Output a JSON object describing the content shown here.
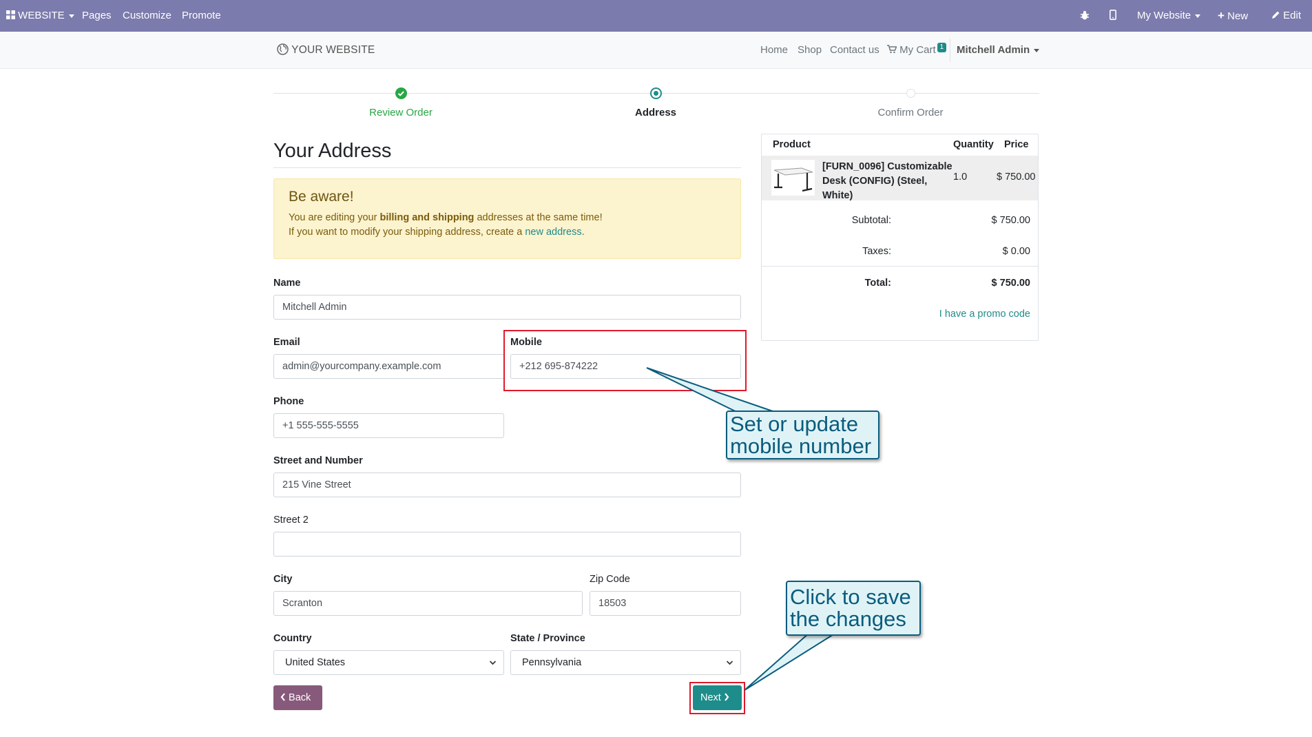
{
  "topbar": {
    "website_label": "WEBSITE",
    "pages": "Pages",
    "customize": "Customize",
    "promote": "Promote",
    "my_website": "My Website",
    "new": "New",
    "edit": "Edit"
  },
  "navbar": {
    "logo": "YOUR WEBSITE",
    "home": "Home",
    "shop": "Shop",
    "contact": "Contact us",
    "cart": "My Cart",
    "cart_count": "1",
    "user": "Mitchell Admin"
  },
  "steps": {
    "review": "Review Order",
    "address": "Address",
    "confirm": "Confirm Order"
  },
  "page_title": "Your Address",
  "alert": {
    "title": "Be aware!",
    "line1_pre": "You are editing your ",
    "line1_bold": "billing and shipping",
    "line1_post": " addresses at the same time!",
    "line2_pre": "If you want to modify your shipping address, create a ",
    "line2_link": "new address",
    "line2_post": "."
  },
  "form": {
    "name_label": "Name",
    "name_value": "Mitchell Admin",
    "email_label": "Email",
    "email_value": "admin@yourcompany.example.com",
    "mobile_label": "Mobile",
    "mobile_value": "+212 695-874222",
    "phone_label": "Phone",
    "phone_value": "+1 555-555-5555",
    "street_label": "Street and Number",
    "street_value": "215 Vine Street",
    "street2_label": "Street 2",
    "street2_value": "",
    "city_label": "City",
    "city_value": "Scranton",
    "zip_label": "Zip Code",
    "zip_value": "18503",
    "country_label": "Country",
    "country_value": "United States",
    "state_label": "State / Province",
    "state_value": "Pennsylvania",
    "back_label": "Back",
    "next_label": "Next"
  },
  "order": {
    "col_product": "Product",
    "col_quantity": "Quantity",
    "col_price": "Price",
    "product_line1": "[FURN_0096] Customizable",
    "product_line2": "Desk (CONFIG) (Steel,",
    "product_line3": "White)",
    "quantity": "1.0",
    "price": "$ 750.00",
    "subtotal_label": "Subtotal:",
    "subtotal_value": "$ 750.00",
    "taxes_label": "Taxes:",
    "taxes_value": "$ 0.00",
    "total_label": "Total:",
    "total_value": "$ 750.00",
    "promo": "I have a promo code"
  },
  "callouts": {
    "mobile_line1": "Set or update",
    "mobile_line2": "mobile number",
    "save_line1": "Click to save",
    "save_line2": "the changes"
  },
  "colors": {
    "topbar": "#7c7bad",
    "accent": "#1e8c8a",
    "step_done": "#28a745",
    "back_button": "#875a7b",
    "highlight": "#e0192a"
  }
}
